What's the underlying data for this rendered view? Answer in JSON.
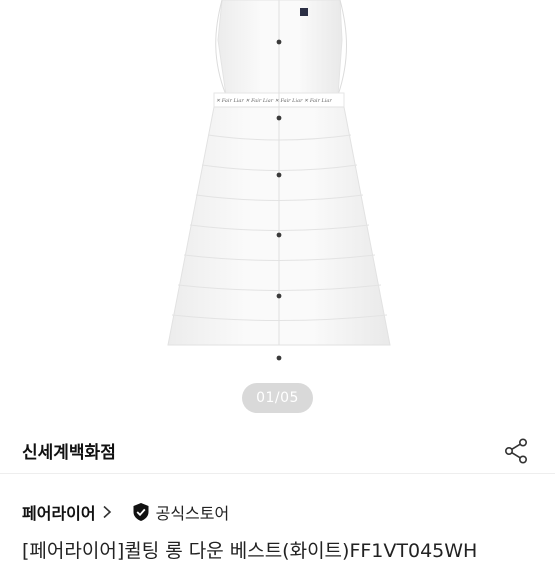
{
  "gallery": {
    "current_page": "01/05",
    "image_alt": "long down vest white"
  },
  "store": {
    "name": "신세계백화점"
  },
  "brand": {
    "name": "페어라이어",
    "official_store_label": "공식스토어"
  },
  "product": {
    "title": "[페어라이어]퀼팅 롱 다운 베스트(화이트)FF1VT045WH"
  },
  "icons": {
    "share": "share-icon",
    "chevron": "chevron-right-icon",
    "official": "shield-check-icon"
  }
}
